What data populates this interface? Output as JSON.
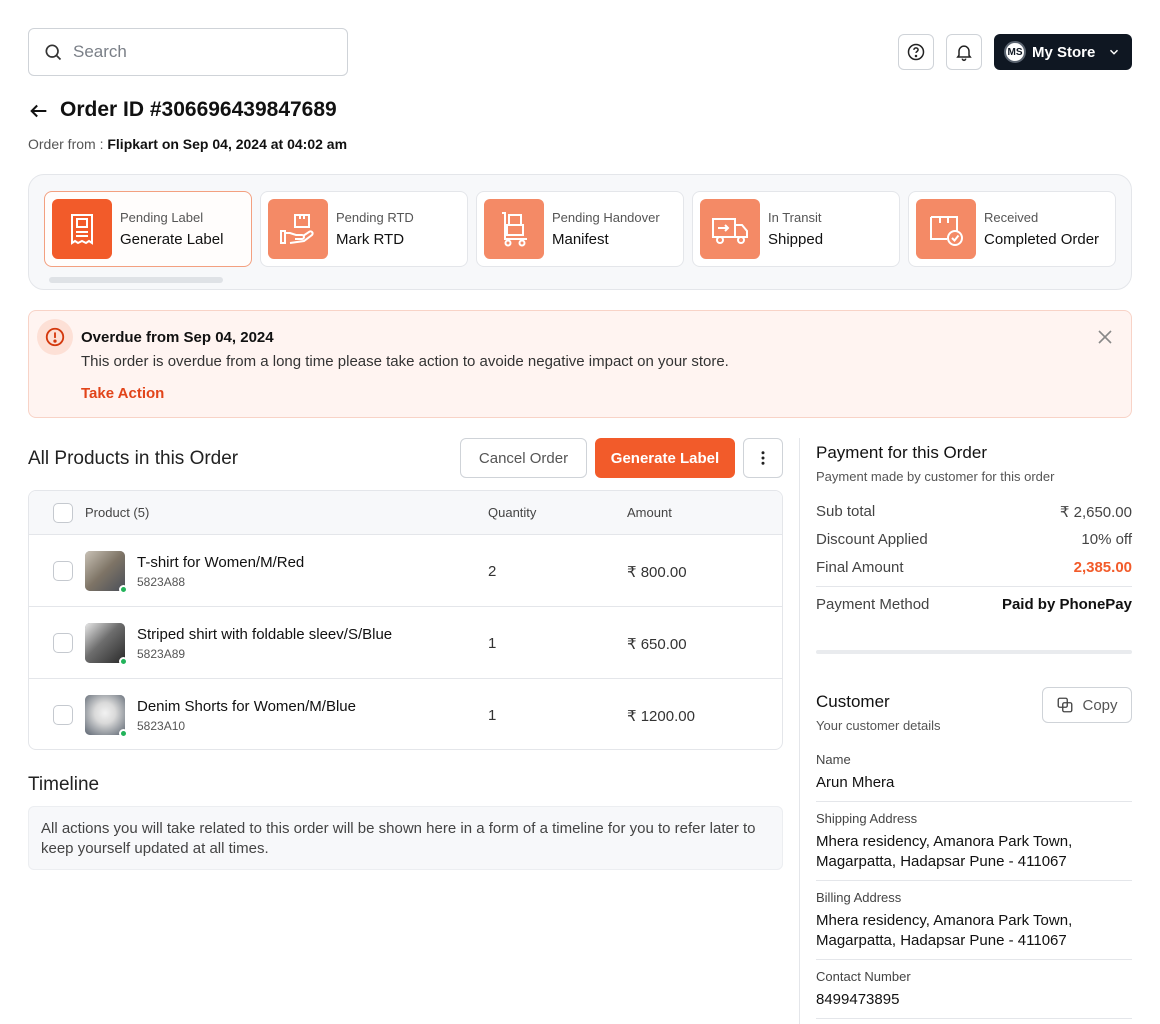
{
  "search": {
    "placeholder": "Search"
  },
  "store": {
    "initials": "MS",
    "name": "My Store"
  },
  "order": {
    "title": "Order ID #306696439847689",
    "from_label": "Order from :",
    "from_value": "Flipkart on Sep 04, 2024 at 04:02 am"
  },
  "statuses": [
    {
      "sub": "Pending Label",
      "main": "Generate Label",
      "icon": "receipt-icon",
      "active": true
    },
    {
      "sub": "Pending RTD",
      "main": "Mark RTD",
      "icon": "hand-box-icon",
      "active": false
    },
    {
      "sub": "Pending Handover",
      "main": "Manifest",
      "icon": "trolley-icon",
      "active": false
    },
    {
      "sub": "In Transit",
      "main": "Shipped",
      "icon": "truck-icon",
      "active": false
    },
    {
      "sub": "Received",
      "main": "Completed Order",
      "icon": "box-check-icon",
      "active": false
    }
  ],
  "alert": {
    "title": "Overdue from Sep 04, 2024",
    "message": "This order is overdue from a long time please take action to avoide negative impact on your store.",
    "action": "Take Action"
  },
  "products": {
    "title": "All Products in this Order",
    "cancel_label": "Cancel Order",
    "generate_label": "Generate Label",
    "columns": {
      "product": "Product (5)",
      "quantity": "Quantity",
      "amount": "Amount"
    },
    "rows": [
      {
        "name": "T-shirt for Women/M/Red",
        "sku": "5823A88",
        "qty": "2",
        "amount": "₹ 800.00"
      },
      {
        "name": "Striped shirt with foldable sleev/S/Blue",
        "sku": "5823A89",
        "qty": "1",
        "amount": "₹ 650.00"
      },
      {
        "name": "Denim Shorts for Women/M/Blue",
        "sku": "5823A10",
        "qty": "1",
        "amount": "₹ 1200.00"
      }
    ]
  },
  "timeline": {
    "title": "Timeline",
    "text": "All actions you will take related to this order will be shown here in a form of a timeline for you to refer later to keep yourself updated at all times."
  },
  "payment": {
    "title": "Payment for this Order",
    "subtitle": "Payment made by customer for this order",
    "subtotal_label": "Sub total",
    "subtotal": "₹ 2,650.00",
    "discount_label": "Discount Applied",
    "discount": "10% off",
    "final_label": "Final Amount",
    "final": "2,385.00",
    "method_label": "Payment Method",
    "method": "Paid by PhonePay"
  },
  "customer": {
    "title": "Customer",
    "subtitle": "Your customer details",
    "copy_label": "Copy",
    "name_label": "Name",
    "name": "Arun Mhera",
    "shipping_label": "Shipping Address",
    "shipping": "Mhera residency, Amanora Park Town, Magarpatta, Hadapsar Pune - 411067",
    "billing_label": "Billing Address",
    "billing": "Mhera residency, Amanora Park Town, Magarpatta, Hadapsar Pune - 411067",
    "contact_label": "Contact Number",
    "contact": "8499473895"
  },
  "colors": {
    "accent": "#f25b2a",
    "accent_soft": "#f48a66",
    "dark": "#0f1722",
    "alert_bg": "#fff4f1"
  }
}
